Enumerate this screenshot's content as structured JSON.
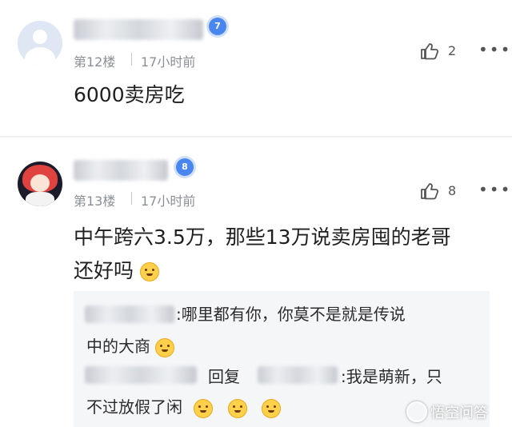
{
  "comments": [
    {
      "level_badge": "7",
      "floor": "第12楼",
      "time": "17小时前",
      "like_count": "2",
      "content": "6000卖房吃"
    },
    {
      "level_badge": "8",
      "floor": "第13楼",
      "time": "17小时前",
      "like_count": "8",
      "content_line1": "中午跨六3.5万，那些13万说卖房囤的老哥",
      "content_line2": "还好吗",
      "replies": [
        {
          "line1": ":哪里都有你，你莫不是就是传说",
          "line2": "中的大商"
        },
        {
          "reply_word": "回复",
          "line1": ":我是萌新，只",
          "line2": "不过放假了闲"
        }
      ]
    }
  ],
  "watermark": {
    "text": "悟空问答"
  },
  "icons": {
    "like": "thumbs-up-icon",
    "more": "more-dots-icon",
    "emoji": "laughing-emoji-icon"
  },
  "colors": {
    "badge": "#4a86f0",
    "meta_text": "#8b8f96",
    "reply_bg": "#f5f6f8"
  }
}
